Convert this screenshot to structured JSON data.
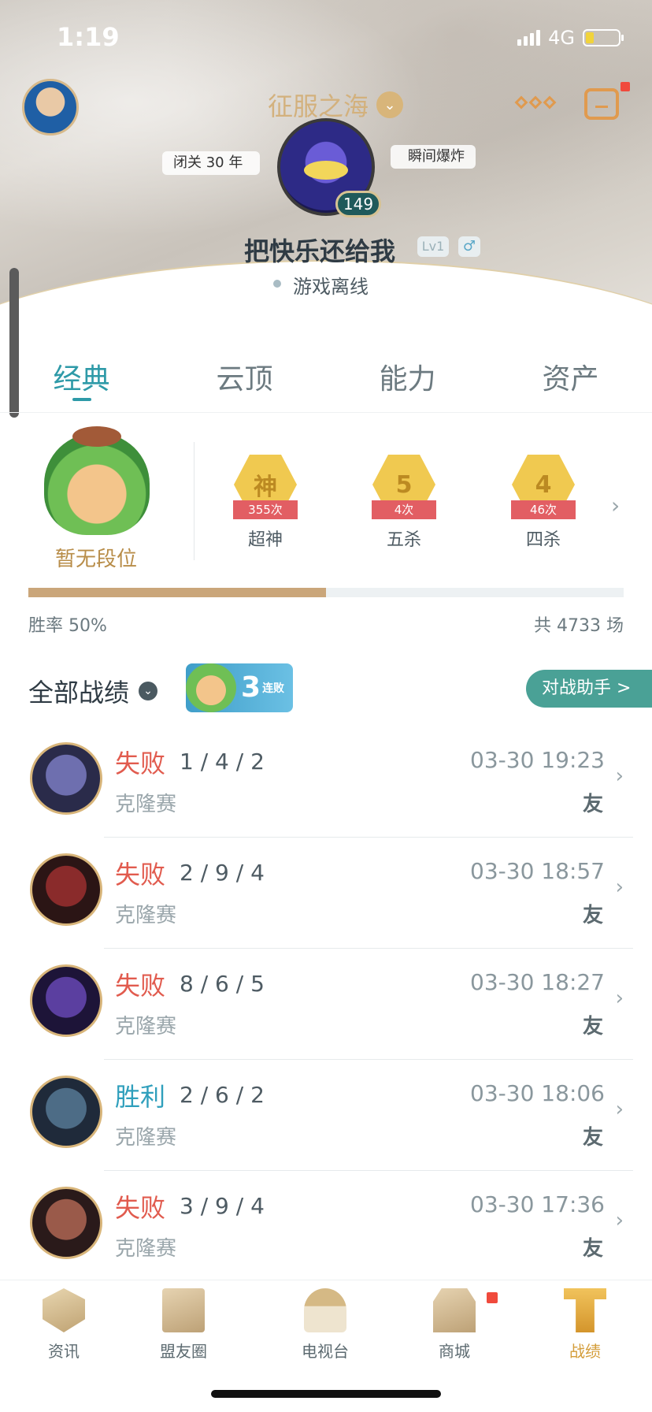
{
  "status_bar": {
    "time": "1:19",
    "network": "4G"
  },
  "header": {
    "realm": "征服之海",
    "left_tag": "闭关 30 年",
    "right_tag": "瞬间爆炸",
    "level": "149",
    "nickname": "把快乐还给我",
    "lv_badge": "Lv1",
    "gender_symbol": "♂",
    "status": "游戏离线"
  },
  "tabs": [
    "经典",
    "云顶",
    "能力",
    "资产"
  ],
  "rank": {
    "label": "暂无段位",
    "achievements": [
      {
        "glyph": "神",
        "count": "355次",
        "label": "超神"
      },
      {
        "glyph": "5",
        "count": "4次",
        "label": "五杀"
      },
      {
        "glyph": "4",
        "count": "46次",
        "label": "四杀"
      }
    ]
  },
  "stats": {
    "winrate_label": "胜率 50%",
    "total_label": "共 4733 场",
    "winrate_fraction": 0.5
  },
  "records": {
    "title": "全部战绩",
    "streak_number": "3",
    "streak_text": "连败",
    "assistant_button": "对战助手 >"
  },
  "matches": [
    {
      "result": "失败",
      "outcome": "lose",
      "kda": "1 / 4 / 2",
      "time": "03-30 19:23",
      "mode": "克隆赛",
      "tag": "友"
    },
    {
      "result": "失败",
      "outcome": "lose",
      "kda": "2 / 9 / 4",
      "time": "03-30 18:57",
      "mode": "克隆赛",
      "tag": "友"
    },
    {
      "result": "失败",
      "outcome": "lose",
      "kda": "8 / 6 / 5",
      "time": "03-30 18:27",
      "mode": "克隆赛",
      "tag": "友"
    },
    {
      "result": "胜利",
      "outcome": "win",
      "kda": "2 / 6 / 2",
      "time": "03-30 18:06",
      "mode": "克隆赛",
      "tag": "友"
    },
    {
      "result": "失败",
      "outcome": "lose",
      "kda": "3 / 9 / 4",
      "time": "03-30 17:36",
      "mode": "克隆赛",
      "tag": "友"
    }
  ],
  "bottom_nav": [
    {
      "label": "资讯",
      "icon": "news-icon"
    },
    {
      "label": "盟友圈",
      "icon": "friends-icon"
    },
    {
      "label": "电视台",
      "icon": "tv-icon"
    },
    {
      "label": "商城",
      "icon": "shop-icon"
    },
    {
      "label": "战绩",
      "icon": "records-icon"
    }
  ],
  "colors": {
    "accent_teal": "#2e9aa8",
    "lose_red": "#e15b4e",
    "win_blue": "#2f9fbc",
    "gold": "#d49d3a"
  }
}
